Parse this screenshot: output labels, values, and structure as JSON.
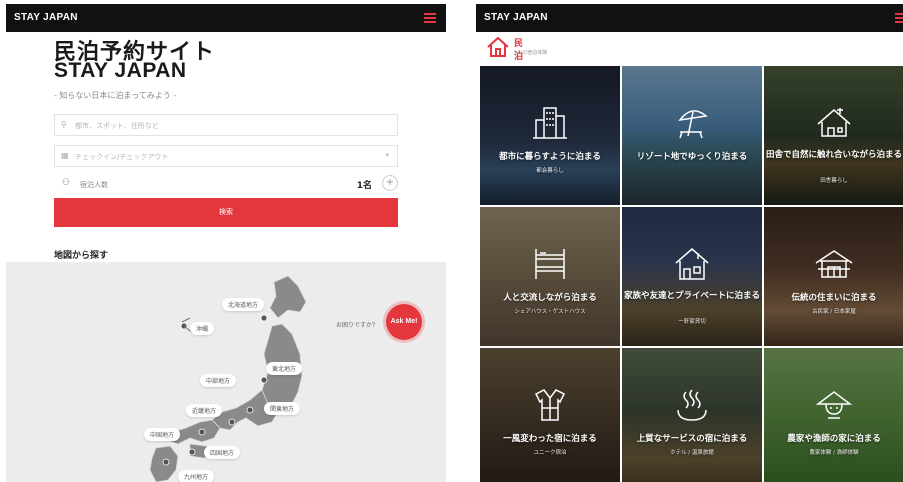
{
  "left_screen": {
    "brand": "STAY JAPAN",
    "title_ja": "民泊予約サイト",
    "title_en": "STAY JAPAN",
    "tagline": "- 知らない日本に泊まってみよう -",
    "search_placeholder": "都市、スポット、住所など",
    "date_placeholder": "チェックイン/チェックアウト",
    "guests_label": "宿泊人数",
    "guests_value": "1名",
    "plus_label": "+",
    "search_button": "検索",
    "map_heading": "地図から探す",
    "help_text": "お困りですか？",
    "ask_me": "Ask Me!",
    "regions": [
      "北海道地方",
      "沖縄",
      "東北地方",
      "中部地方",
      "関東地方",
      "近畿地方",
      "中国地方",
      "四国地方",
      "九州地方"
    ]
  },
  "right_screen": {
    "brand": "STAY JAPAN",
    "category_title": "民泊",
    "category_subtitle": "9つの宿泊体験",
    "tiles": [
      {
        "title": "都市に暮らすように泊まる",
        "subtitle": "都会暮らし",
        "icon": "city-icon"
      },
      {
        "title": "リゾート地でゆっくり泊まる",
        "subtitle": "",
        "icon": "parasol-icon"
      },
      {
        "title": "田舎で自然に触れ合いながら泊まる",
        "subtitle": "田舎暮らし",
        "icon": "farmhouse-icon"
      },
      {
        "title": "人と交流しながら泊まる",
        "subtitle": "シェアハウス・ゲストハウス",
        "icon": "bunkbed-icon"
      },
      {
        "title": "家族や友達とプライベートに泊まる",
        "subtitle": "一軒家貸切",
        "icon": "house-icon"
      },
      {
        "title": "伝統の住まいに泊まる",
        "subtitle": "古民家 / 日本家屋",
        "icon": "traditional-house-icon"
      },
      {
        "title": "一風変わった宿に泊まる",
        "subtitle": "ユニーク宿泊",
        "icon": "kimono-icon"
      },
      {
        "title": "上質なサービスの宿に泊まる",
        "subtitle": "ホテル / 温泉旅館",
        "icon": "onsen-icon"
      },
      {
        "title": "農家や漁師の家に泊まる",
        "subtitle": "農家体験 / 漁師体験",
        "icon": "farmer-hat-icon"
      }
    ]
  },
  "colors": {
    "accent": "#e4373d",
    "topbar": "#111111"
  }
}
